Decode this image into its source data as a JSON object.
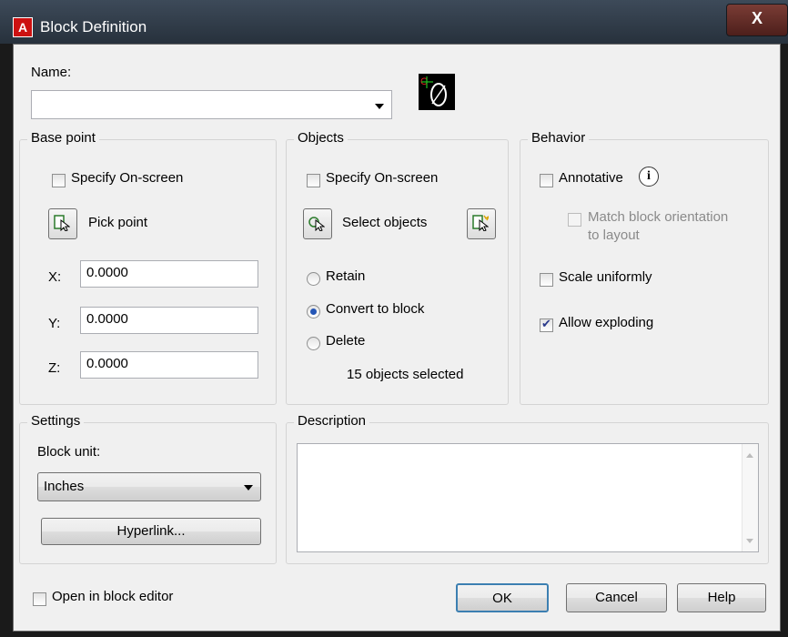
{
  "window": {
    "title": "Block Definition",
    "close_label": "X",
    "app_icon_letter": "A"
  },
  "name": {
    "label": "Name:",
    "value": ""
  },
  "base_point": {
    "title": "Base point",
    "specify_onscreen": {
      "label": "Specify On-screen",
      "checked": false
    },
    "pick_point_label": "Pick point",
    "x": {
      "label": "X:",
      "value": "0.0000"
    },
    "y": {
      "label": "Y:",
      "value": "0.0000"
    },
    "z": {
      "label": "Z:",
      "value": "0.0000"
    }
  },
  "objects": {
    "title": "Objects",
    "specify_onscreen": {
      "label": "Specify On-screen",
      "checked": false
    },
    "select_objects_label": "Select objects",
    "retain_label": "Retain",
    "convert_label": "Convert to block",
    "delete_label": "Delete",
    "selected_mode": "convert",
    "status": "15 objects selected"
  },
  "behavior": {
    "title": "Behavior",
    "annotative": {
      "label": "Annotative",
      "checked": false
    },
    "match_orientation": {
      "label_line1": "Match block orientation",
      "label_line2": "to layout",
      "checked": false,
      "enabled": false
    },
    "scale_uniformly": {
      "label": "Scale uniformly",
      "checked": false
    },
    "allow_exploding": {
      "label": "Allow exploding",
      "checked": true
    }
  },
  "settings": {
    "title": "Settings",
    "block_unit_label": "Block unit:",
    "block_unit_value": "Inches",
    "hyperlink_label": "Hyperlink..."
  },
  "description": {
    "title": "Description",
    "value": ""
  },
  "footer": {
    "open_in_block_editor": {
      "label": "Open in block editor",
      "checked": false
    },
    "ok_label": "OK",
    "cancel_label": "Cancel",
    "help_label": "Help"
  },
  "colors": {
    "titlebar": "#2f3a46",
    "dialog_bg": "#f0f0f0",
    "default_button_border": "#3c7fb1"
  }
}
